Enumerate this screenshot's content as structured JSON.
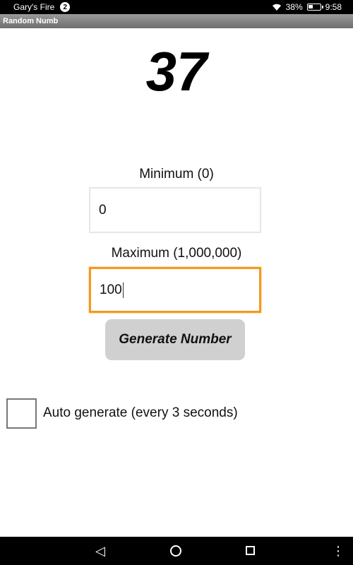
{
  "status_bar": {
    "owner": "Gary's Fire",
    "notification_count": "2",
    "battery": "38%",
    "time": "9:58",
    "battery_level": 0.38
  },
  "app": {
    "title": "Random Numb"
  },
  "result": "37",
  "minimum": {
    "label": "Minimum (0)",
    "value": "0"
  },
  "maximum": {
    "label": "Maximum (1,000,000)",
    "value": "100"
  },
  "generate_label": "Generate Number",
  "auto_generate": {
    "label": "Auto generate (every 3 seconds)",
    "checked": false
  },
  "nav": {
    "back": "◁",
    "home": "",
    "recent": "",
    "menu": "⋮"
  },
  "colors": {
    "focus_border": "#f39a1f",
    "button_bg": "#d0d0d0",
    "title_bar": "#808080"
  }
}
